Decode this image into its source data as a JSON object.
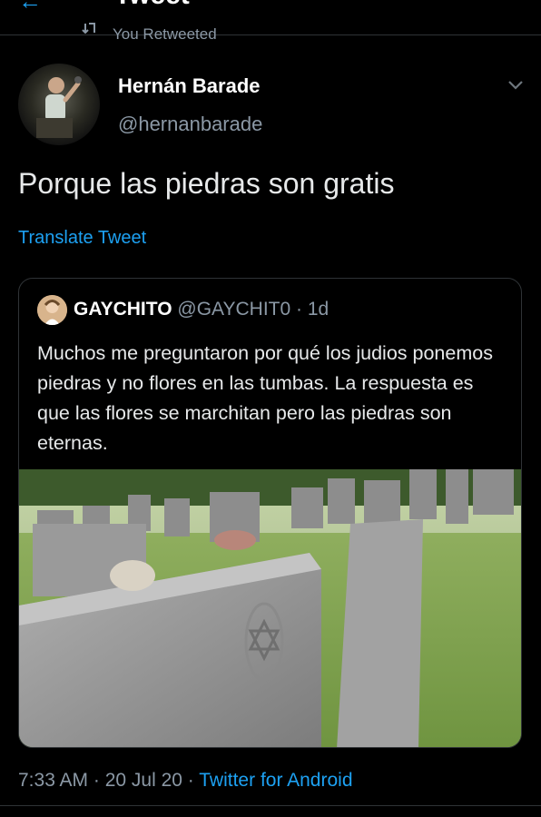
{
  "header": {
    "title": "Tweet"
  },
  "retweet_context": {
    "label": "You Retweeted"
  },
  "tweet": {
    "author_name": "Hernán Barade",
    "author_handle": "@hernanbarade",
    "text": "Porque las piedras son gratis",
    "translate_label": "Translate Tweet",
    "timestamp": "7:33 AM · 20 Jul 20",
    "separator": "·",
    "source": "Twitter for Android"
  },
  "quoted_tweet": {
    "author_name": "GAYCHITO",
    "author_handle": "@GAYCHIT0",
    "separator": "·",
    "time": "1d",
    "text": "Muchos me preguntaron por qué los judios ponemos piedras y no flores en las tumbas. La respuesta es que las flores se marchitan pero las piedras son eternas."
  },
  "colors": {
    "background": "#000000",
    "accent": "#1da1f2",
    "secondary_text": "#8b98a5",
    "border": "#2f3336"
  },
  "icons": {
    "back": "back-arrow-icon",
    "retweet": "retweet-icon",
    "more": "chevron-down-icon"
  }
}
